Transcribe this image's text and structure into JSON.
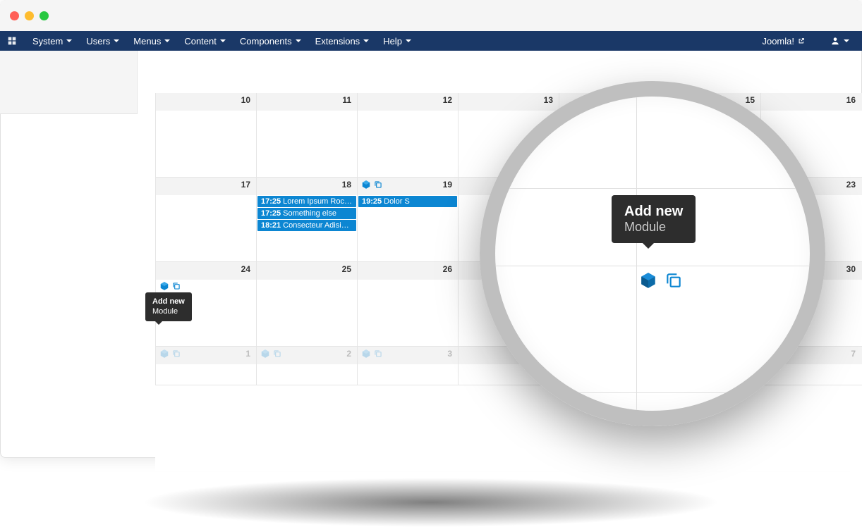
{
  "nav": {
    "items": [
      "System",
      "Users",
      "Menus",
      "Content",
      "Components",
      "Extensions",
      "Help"
    ],
    "site": "Joomla!"
  },
  "calendar": {
    "rows": [
      {
        "dates": [
          "10",
          "11",
          "12",
          "13",
          "",
          "15",
          "16"
        ],
        "dim": [],
        "events": []
      },
      {
        "dates": [
          "17",
          "18",
          "19",
          "",
          "",
          "",
          "23"
        ],
        "dim": [],
        "events_col": 1,
        "events": [
          {
            "time": "17:25",
            "title": "Lorem Ipsum Rocks!"
          },
          {
            "time": "17:25",
            "title": "Something else"
          },
          {
            "time": "18:21",
            "title": "Consecteur Adisiping"
          }
        ],
        "events2_col": 2,
        "events2": [
          {
            "time": "19:25",
            "title": "Dolor S"
          }
        ],
        "icons_col": 2
      },
      {
        "dates": [
          "24",
          "25",
          "26",
          "",
          "",
          "",
          "30"
        ],
        "dim": [],
        "hover_icons": [
          0
        ]
      },
      {
        "dates": [
          "1",
          "2",
          "3",
          "",
          "",
          "",
          "7"
        ],
        "dim": [
          0,
          1,
          2,
          6
        ],
        "dim_icons": [
          0,
          1,
          2,
          6
        ]
      }
    ]
  },
  "tooltip": {
    "title": "Add new",
    "sub": "Module"
  },
  "mag_tooltip": {
    "title": "Add new",
    "sub": "Module"
  },
  "colors": {
    "primary": "#0c86d2",
    "nav": "#1a3867"
  }
}
